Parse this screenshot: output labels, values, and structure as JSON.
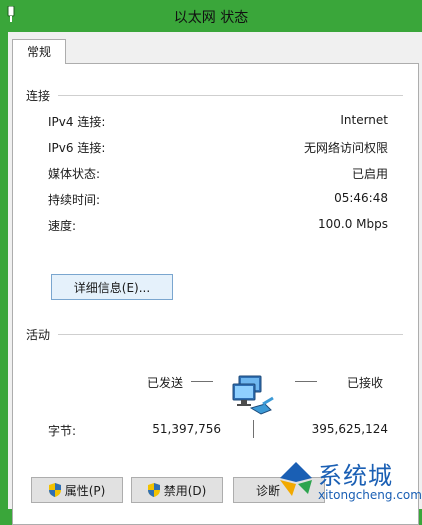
{
  "window": {
    "title": "以太网 状态"
  },
  "tabs": [
    {
      "label": "常规"
    }
  ],
  "connection": {
    "section_label": "连接",
    "rows": [
      {
        "label": "IPv4 连接:",
        "value": "Internet"
      },
      {
        "label": "IPv6 连接:",
        "value": "无网络访问权限"
      },
      {
        "label": "媒体状态:",
        "value": "已启用"
      },
      {
        "label": "持续时间:",
        "value": "05:46:48"
      },
      {
        "label": "速度:",
        "value": "100.0 Mbps"
      }
    ],
    "details_button": "详细信息(E)..."
  },
  "activity": {
    "section_label": "活动",
    "sent_label": "已发送",
    "received_label": "已接收",
    "bytes_label": "字节:",
    "bytes_sent": "51,397,756",
    "bytes_received": "395,625,124"
  },
  "buttons": {
    "properties": "属性(P)",
    "disable": "禁用(D)",
    "diagnose": "诊断"
  },
  "watermark": {
    "text": "系统城",
    "url": "xitongcheng.com"
  }
}
